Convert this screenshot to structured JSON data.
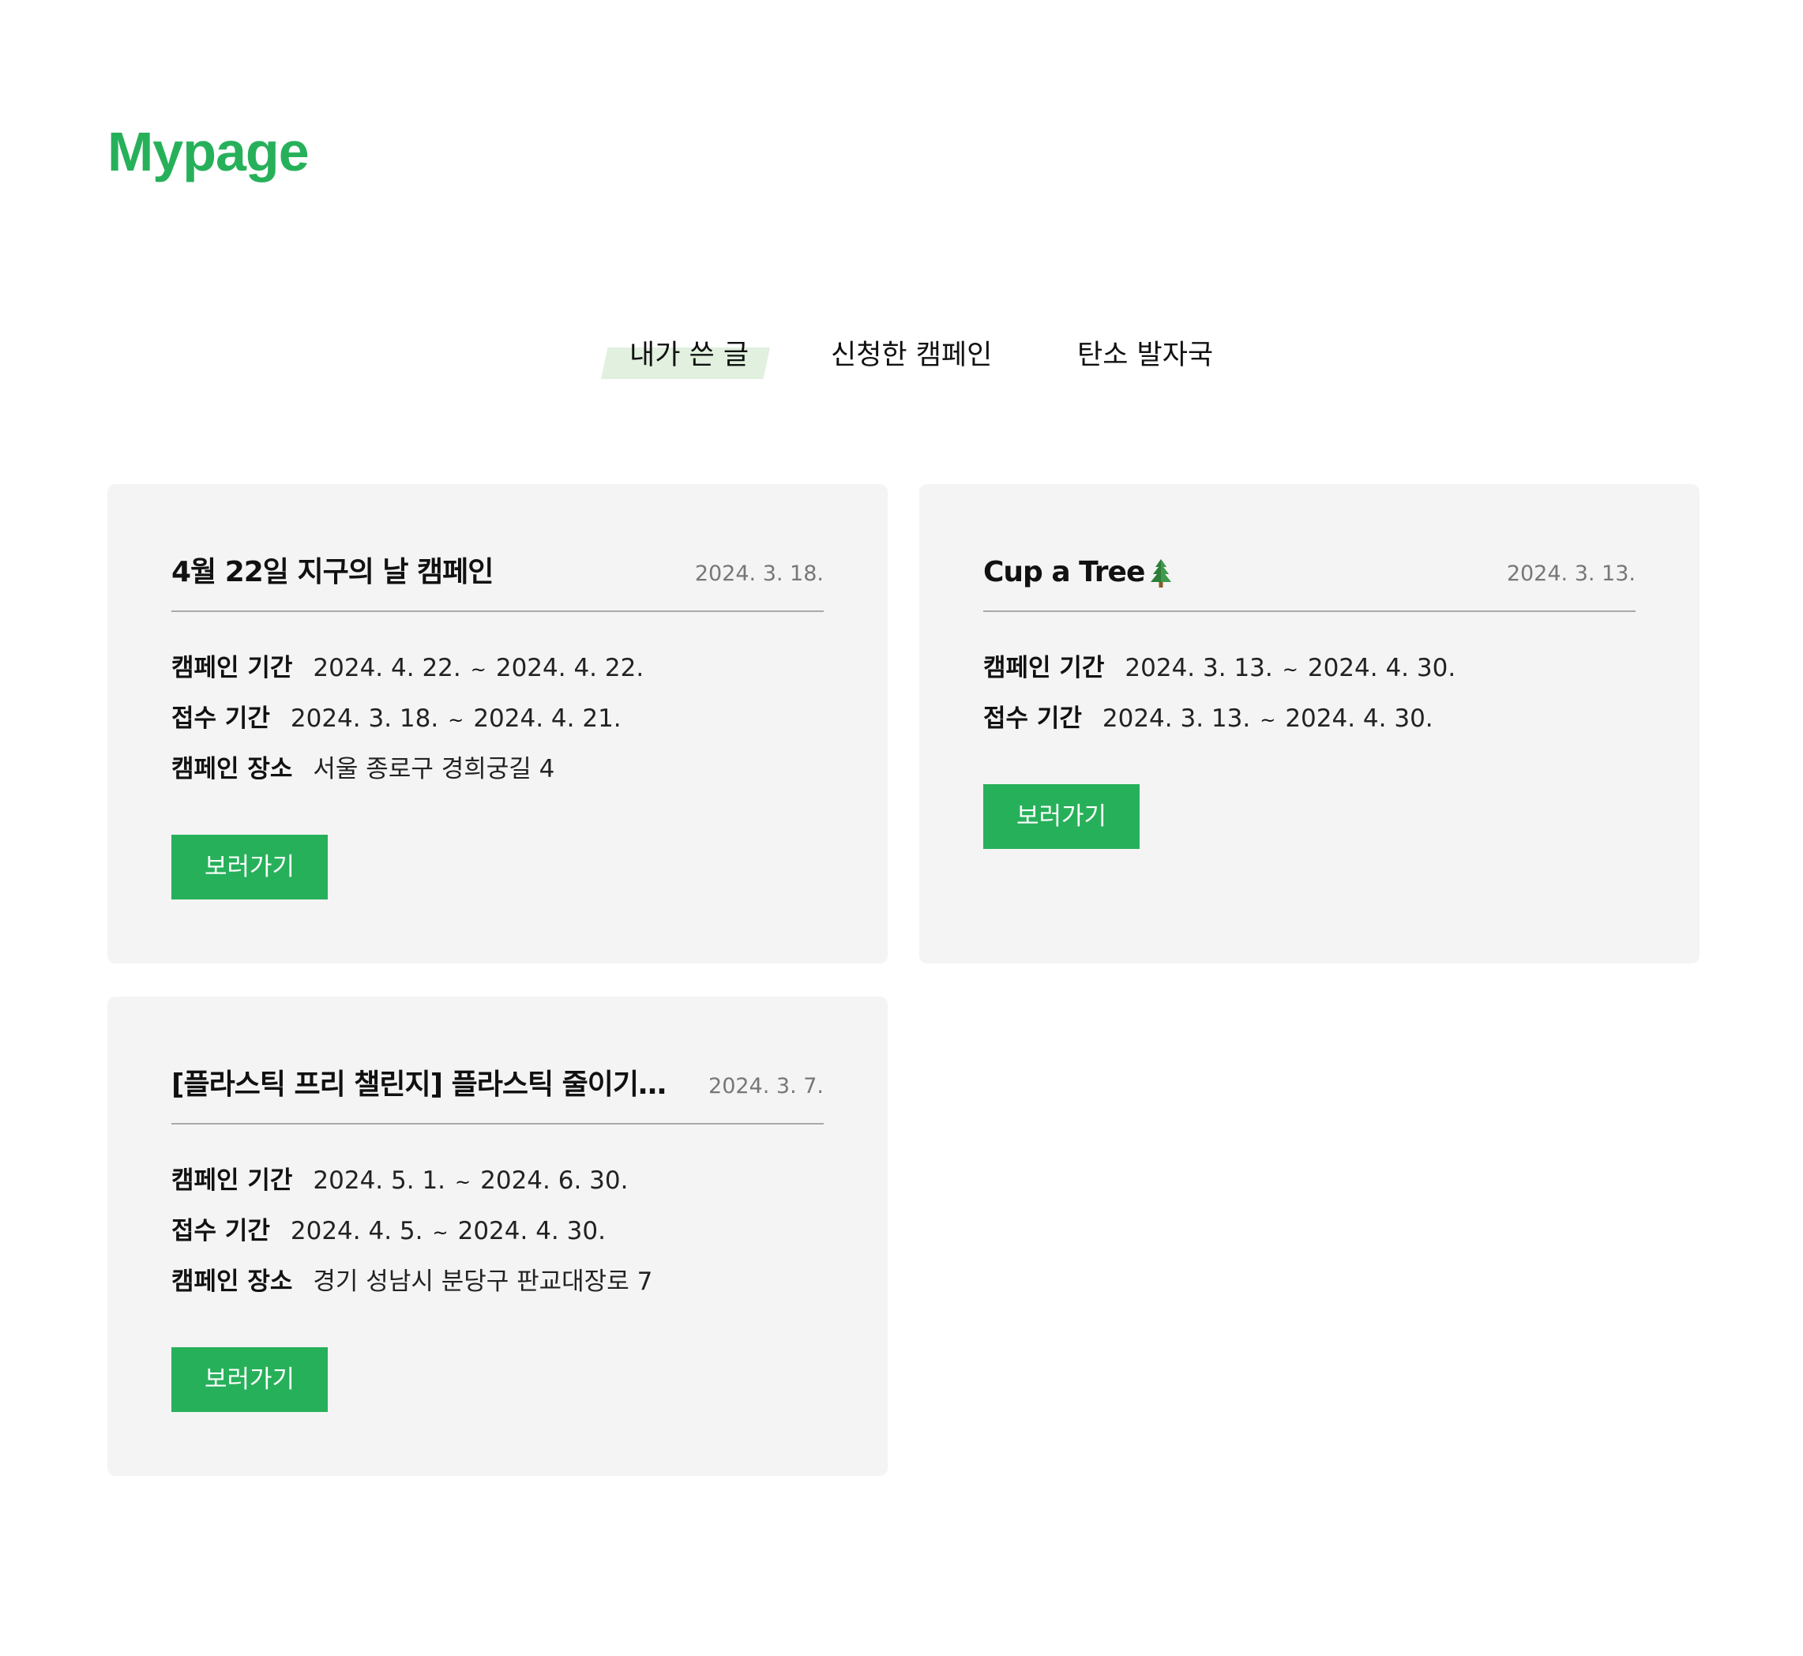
{
  "page": {
    "title": "Mypage"
  },
  "tabs": [
    {
      "label": "내가 쓴 글",
      "active": true
    },
    {
      "label": "신청한 캠페인",
      "active": false
    },
    {
      "label": "탄소 발자국",
      "active": false
    }
  ],
  "colors": {
    "accent": "#27b05a",
    "active_tab_highlight": "#e1f0df",
    "card_background": "#f4f4f4"
  },
  "labels": {
    "campaign_period": "캠페인 기간",
    "application_period": "접수 기간",
    "campaign_location": "캠페인 장소",
    "tilde": "~"
  },
  "posts": [
    {
      "title": "4월 22일 지구의 날 캠페인",
      "date": "2024. 3. 18.",
      "campaign_start": "2024. 4. 22.",
      "campaign_end": "2024. 4. 22.",
      "application_start": "2024. 3. 18.",
      "application_end": "2024. 4. 21.",
      "location": "서울 종로구 경희궁길 4",
      "button_label": "보러가기"
    },
    {
      "title": "Cup a Tree",
      "title_icon": "evergreen-tree-icon",
      "date": "2024. 3. 13.",
      "campaign_start": "2024. 3. 13.",
      "campaign_end": "2024. 4. 30.",
      "application_start": "2024. 3. 13.",
      "application_end": "2024. 4. 30.",
      "button_label": "보러가기"
    },
    {
      "title": "[플라스틱 프리 챌린지] 플라스틱 줄이기…",
      "date": "2024. 3. 7.",
      "campaign_start": "2024. 5. 1.",
      "campaign_end": "2024. 6. 30.",
      "application_start": "2024. 4. 5.",
      "application_end": "2024. 4. 30.",
      "location": "경기 성남시 분당구 판교대장로 7",
      "button_label": "보러가기"
    }
  ]
}
